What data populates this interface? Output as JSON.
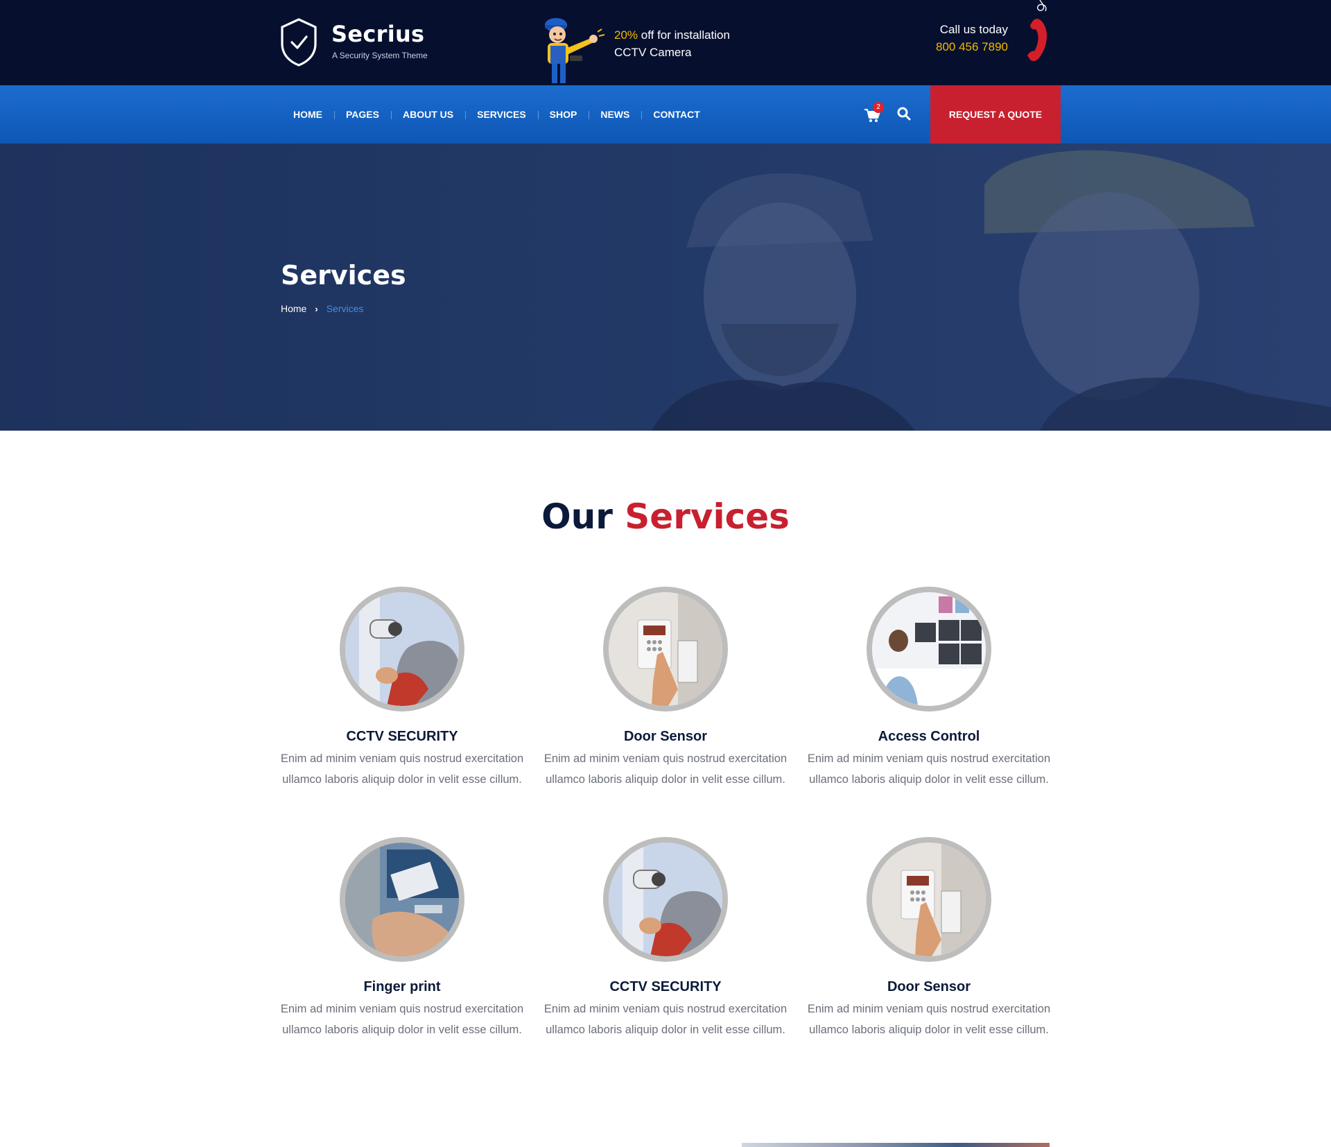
{
  "header": {
    "brand": "Secrius",
    "tagline": "A Security System Theme",
    "promo": {
      "highlight": "20%",
      "line1_rest": " off for installation",
      "line2": "CCTV Camera"
    },
    "call": {
      "label": "Call us today",
      "number": "800 456 7890"
    }
  },
  "nav": {
    "items": [
      {
        "label": "HOME"
      },
      {
        "label": "PAGES"
      },
      {
        "label": "ABOUT US"
      },
      {
        "label": "SERVICES"
      },
      {
        "label": "SHOP"
      },
      {
        "label": "NEWS"
      },
      {
        "label": "CONTACT"
      }
    ],
    "cart_count": "2",
    "quote_label": "REQUEST A QUOTE"
  },
  "hero": {
    "title": "Services",
    "breadcrumb": {
      "home": "Home",
      "current": "Services"
    }
  },
  "services": {
    "title_dark": "Our",
    "title_red": "Services",
    "cards": [
      {
        "title": "CCTV SECURITY",
        "desc": "Enim ad minim veniam quis nostrud exercitation ullamco laboris aliquip dolor in velit esse cillum.",
        "image": "cctv-camera-photo"
      },
      {
        "title": "Door Sensor",
        "desc": "Enim ad minim veniam quis nostrud exercitation ullamco laboris aliquip dolor in velit esse cillum.",
        "image": "door-sensor-keypad-photo"
      },
      {
        "title": "Access Control",
        "desc": "Enim ad minim veniam quis nostrud exercitation ullamco laboris aliquip dolor in velit esse cillum.",
        "image": "monitoring-room-photo"
      },
      {
        "title": "Finger print",
        "desc": "Enim ad minim veniam quis nostrud exercitation ullamco laboris aliquip dolor in velit esse cillum.",
        "image": "fingerprint-card-photo"
      },
      {
        "title": "CCTV SECURITY",
        "desc": "Enim ad minim veniam quis nostrud exercitation ullamco laboris aliquip dolor in velit esse cillum.",
        "image": "cctv-camera-photo"
      },
      {
        "title": "Door Sensor",
        "desc": "Enim ad minim veniam quis nostrud exercitation ullamco laboris aliquip dolor in velit esse cillum.",
        "image": "door-sensor-keypad-photo"
      }
    ]
  },
  "colors": {
    "topbar": "#06102e",
    "nav": "#1566c6",
    "accent_red": "#c8202f",
    "accent_yellow": "#f5b800",
    "dark_text": "#0b1a3a"
  }
}
